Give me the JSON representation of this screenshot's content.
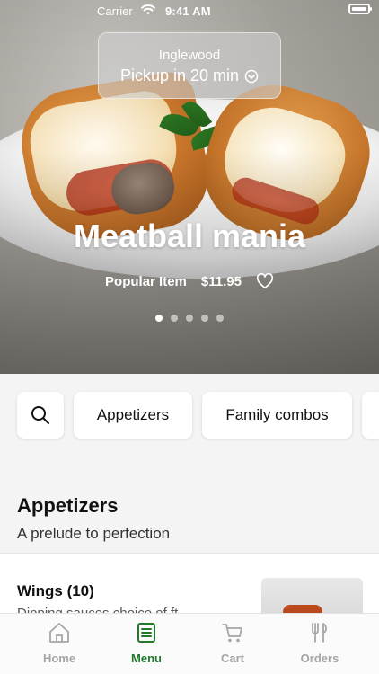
{
  "status_bar": {
    "carrier": "Carrier",
    "time": "9:41 AM"
  },
  "pickup": {
    "location": "Inglewood",
    "label": "Pickup in 20 min"
  },
  "hero": {
    "title": "Meatball mania",
    "tag": "Popular Item",
    "price": "$11.95",
    "slide_count": 5,
    "active_slide": 1
  },
  "categories": {
    "items": [
      "Appetizers",
      "Family combos"
    ]
  },
  "section": {
    "title": "Appetizers",
    "subtitle": "A prelude to perfection"
  },
  "menu_item": {
    "name": "Wings (10)",
    "description_visible": "Dipping sauces choice of ft..."
  },
  "tabs": [
    {
      "label": "Home",
      "icon": "home-icon"
    },
    {
      "label": "Menu",
      "icon": "menu-icon",
      "active": true
    },
    {
      "label": "Cart",
      "icon": "cart-icon"
    },
    {
      "label": "Orders",
      "icon": "orders-icon"
    }
  ],
  "colors": {
    "accent": "#1f7a2b",
    "tab_inactive": "#a5a5a5"
  }
}
